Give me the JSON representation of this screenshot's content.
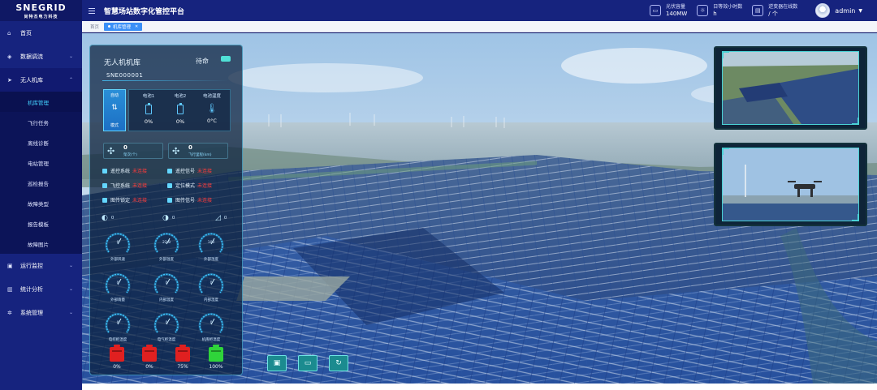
{
  "app": {
    "logo_main": "SNEGRID",
    "logo_sub": "尚特杰电力科技",
    "title": "智慧场站数字化管控平台"
  },
  "header": {
    "stats": [
      {
        "icon": "monitor-icon",
        "label": "光伏容量",
        "value": "140MW"
      },
      {
        "icon": "sun-icon",
        "label": "日等效小时数",
        "value": "h"
      },
      {
        "icon": "inverter-icon",
        "label": "逆变器在线数",
        "value": "/ 个"
      }
    ],
    "user": "admin"
  },
  "sidebar": {
    "items": [
      {
        "label": "首页",
        "icon": "home-icon",
        "arrow": false
      },
      {
        "label": "数据调流",
        "icon": "data-icon",
        "arrow": true
      },
      {
        "label": "无人机库",
        "icon": "plane-icon",
        "arrow": true,
        "open": true
      },
      {
        "label": "运行监控",
        "icon": "monitor-icon",
        "arrow": true
      },
      {
        "label": "统计分析",
        "icon": "chart-icon",
        "arrow": true
      },
      {
        "label": "系统管理",
        "icon": "gear-icon",
        "arrow": true
      }
    ],
    "sub_items": [
      "机库管理",
      "飞行任务",
      "离线诊断",
      "电站管理",
      "巡检报告",
      "故障类型",
      "报告模板",
      "故障图片"
    ],
    "active_sub": "机库管理"
  },
  "tabs": {
    "home": "首页",
    "active": "机库管理"
  },
  "hangar": {
    "title": "无人机机库",
    "status": "待命",
    "serial": "SNE000001",
    "mode_label_top": "自动",
    "mode_label_bottom": "模式",
    "batteries": [
      {
        "label": "电池1",
        "value": "0%"
      },
      {
        "label": "电池2",
        "value": "0%"
      },
      {
        "label": "电池温度",
        "value": "0°C"
      }
    ],
    "counters": [
      {
        "value": "0",
        "label": "架次(个)",
        "icon": "drone-icon"
      },
      {
        "value": "0",
        "label": "飞行里程(km)",
        "icon": "route-icon"
      }
    ],
    "status_items": [
      {
        "label": "遥控系统",
        "value": "未连接"
      },
      {
        "label": "遥控信号",
        "value": "未连接"
      },
      {
        "label": "飞控系统",
        "value": "未连接"
      },
      {
        "label": "定位模式",
        "value": "未连接"
      },
      {
        "label": "图传锁定",
        "value": "未连接"
      },
      {
        "label": "图传信号",
        "value": "未连接"
      }
    ],
    "env": [
      {
        "icon": "wind-icon",
        "value": "0"
      },
      {
        "icon": "rain-icon",
        "value": "0"
      },
      {
        "icon": "tilt-icon",
        "value": "0"
      }
    ],
    "gauges": [
      {
        "label": "外部风速",
        "value": "0"
      },
      {
        "label": "外部温度",
        "value": "22.8"
      },
      {
        "label": "外部湿度",
        "value": "100"
      },
      {
        "label": "外部雨量",
        "value": "0"
      },
      {
        "label": "内部温度",
        "value": "0"
      },
      {
        "label": "内部湿度",
        "value": "0"
      },
      {
        "label": "电控柜温度",
        "value": "0"
      },
      {
        "label": "电气柜温度",
        "value": "0"
      },
      {
        "label": "机库柜温度",
        "value": "0"
      }
    ],
    "charge": [
      {
        "value": "0%",
        "color": "#e02020"
      },
      {
        "value": "0%",
        "color": "#e02020"
      },
      {
        "value": "75%",
        "color": "#e02020"
      },
      {
        "value": "100%",
        "color": "#2fd43a"
      }
    ]
  },
  "bottom_buttons": [
    {
      "icon": "camera-icon"
    },
    {
      "icon": "screen-icon"
    },
    {
      "icon": "refresh-icon"
    }
  ],
  "colors": {
    "nav_bg": "#16237e",
    "accent": "#44d3ff",
    "alert": "#ff3b3b",
    "tab_active": "#3a8ff7"
  }
}
